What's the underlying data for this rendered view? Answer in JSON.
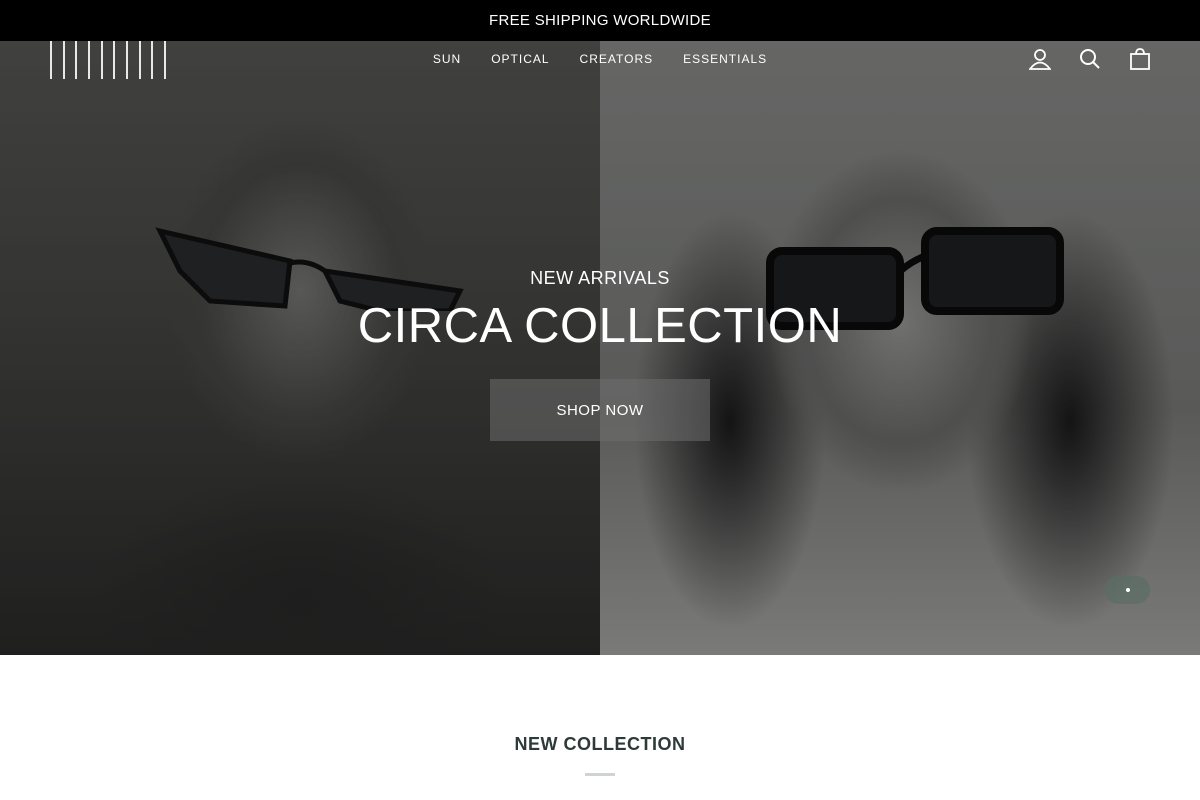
{
  "announcement": {
    "text": "FREE SHIPPING WORLDWIDE"
  },
  "nav": {
    "items": [
      {
        "label": "SUN"
      },
      {
        "label": "OPTICAL"
      },
      {
        "label": "CREATORS"
      },
      {
        "label": "ESSENTIALS"
      }
    ]
  },
  "header_icons": [
    "account-icon",
    "search-icon",
    "cart-icon"
  ],
  "hero": {
    "eyebrow": "NEW ARRIVALS",
    "headline": "CIRCA COLLECTION",
    "cta_label": "SHOP NOW"
  },
  "slideshow": {
    "current": 1,
    "total": 1
  },
  "section": {
    "title": "NEW COLLECTION"
  },
  "colors": {
    "announcement_bg": "#000000",
    "text_light": "#ffffff",
    "section_title": "#2e3a38"
  }
}
